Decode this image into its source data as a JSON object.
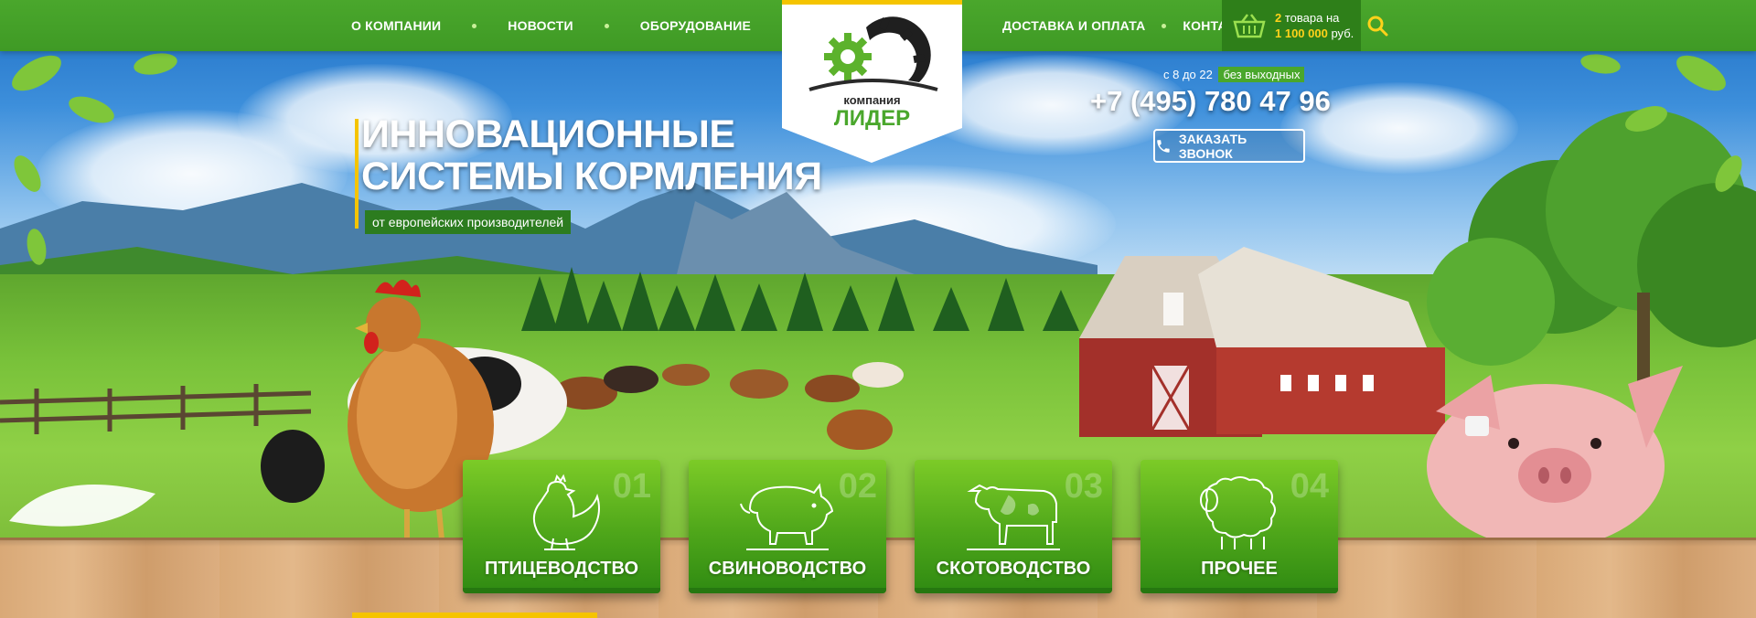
{
  "nav_left": [
    {
      "label": "О компании"
    },
    {
      "label": "Новости"
    },
    {
      "label": "Оборудование"
    }
  ],
  "nav_right": [
    {
      "label": "Доставка и оплата"
    },
    {
      "label": "Контакты"
    }
  ],
  "cart": {
    "count": "2",
    "items_word": "товара на",
    "sum": "1 100 000",
    "currency": "руб."
  },
  "logo": {
    "line1": "компания",
    "line2": "ЛИДЕР"
  },
  "hero": {
    "title_line1": "Инновационные",
    "title_line2": "системы кормления",
    "subtitle": "от европейских производителей"
  },
  "contacts": {
    "hours_prefix": "с 8 до 22",
    "hours_badge": "без выходных",
    "phone": "+7 (495) 780 47 96",
    "callback_label": "Заказать звонок"
  },
  "categories": [
    {
      "num": "01",
      "label": "Птицеводство",
      "icon": "chicken-icon"
    },
    {
      "num": "02",
      "label": "Свиноводство",
      "icon": "pig-icon"
    },
    {
      "num": "03",
      "label": "Скотоводство",
      "icon": "cow-icon"
    },
    {
      "num": "04",
      "label": "Прочее",
      "icon": "sheep-icon"
    }
  ],
  "colors": {
    "brand_green": "#4aa72c",
    "dark_green": "#2e7f19",
    "accent_yellow": "#ffd21a"
  }
}
